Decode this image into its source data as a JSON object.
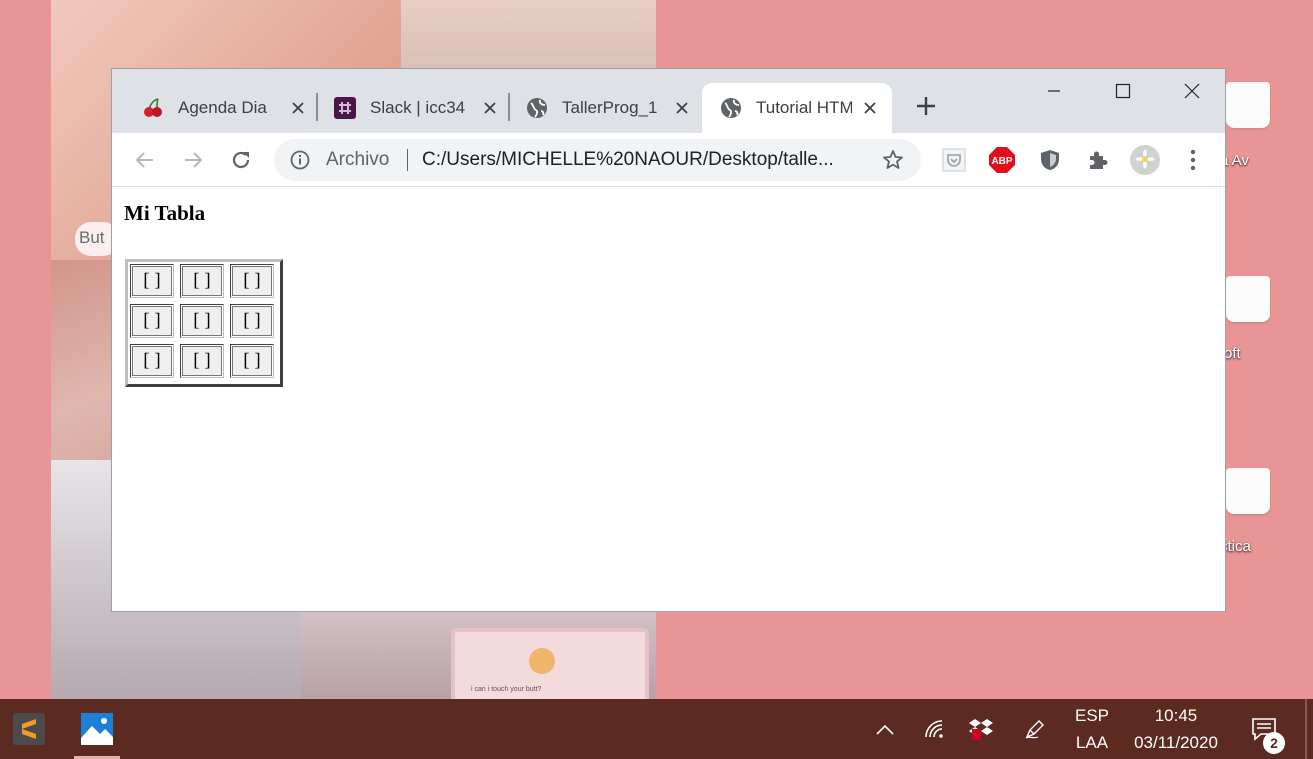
{
  "desktop": {
    "wallpaper_bubble_text": "But",
    "card_text": "i can i touch your butt?",
    "icons": [
      {
        "label": "a Av"
      },
      {
        "label": "oft"
      },
      {
        "label": "ctica"
      }
    ]
  },
  "browser": {
    "tabs": [
      {
        "title": "Agenda Dia",
        "icon": "cherry-icon",
        "active": false
      },
      {
        "title": "Slack | icc34",
        "icon": "slack-icon",
        "active": false
      },
      {
        "title": "TallerProg_1",
        "icon": "globe-icon",
        "active": false
      },
      {
        "title": "Tutorial HTM",
        "icon": "globe-icon",
        "active": true
      }
    ],
    "address_bar": {
      "scheme_label": "Archivo",
      "url": "C:/Users/MICHELLE%20NAOUR/Desktop/talle..."
    },
    "extensions": [
      {
        "name": "pocket-icon"
      },
      {
        "name": "adblock-plus-icon",
        "label": "ABP"
      },
      {
        "name": "shield-icon"
      },
      {
        "name": "puzzle-icon"
      },
      {
        "name": "profile-avatar"
      }
    ]
  },
  "page": {
    "heading": "Mi Tabla",
    "table": {
      "rows": [
        [
          "[ ]",
          "[ ]",
          "[ ]"
        ],
        [
          "[ ]",
          "[ ]",
          "[ ]"
        ],
        [
          "[ ]",
          "[ ]",
          "[ ]"
        ]
      ]
    }
  },
  "taskbar": {
    "apps": [
      "sublime-text-icon",
      "photos-icon"
    ],
    "language_top": "ESP",
    "language_bottom": "LAA",
    "time": "10:45",
    "date": "03/11/2020",
    "notification_count": "2"
  },
  "colors": {
    "desktop_bg": "#e99596",
    "taskbar_bg": "#5b2b22",
    "tabstrip_bg": "#dee1e6"
  }
}
